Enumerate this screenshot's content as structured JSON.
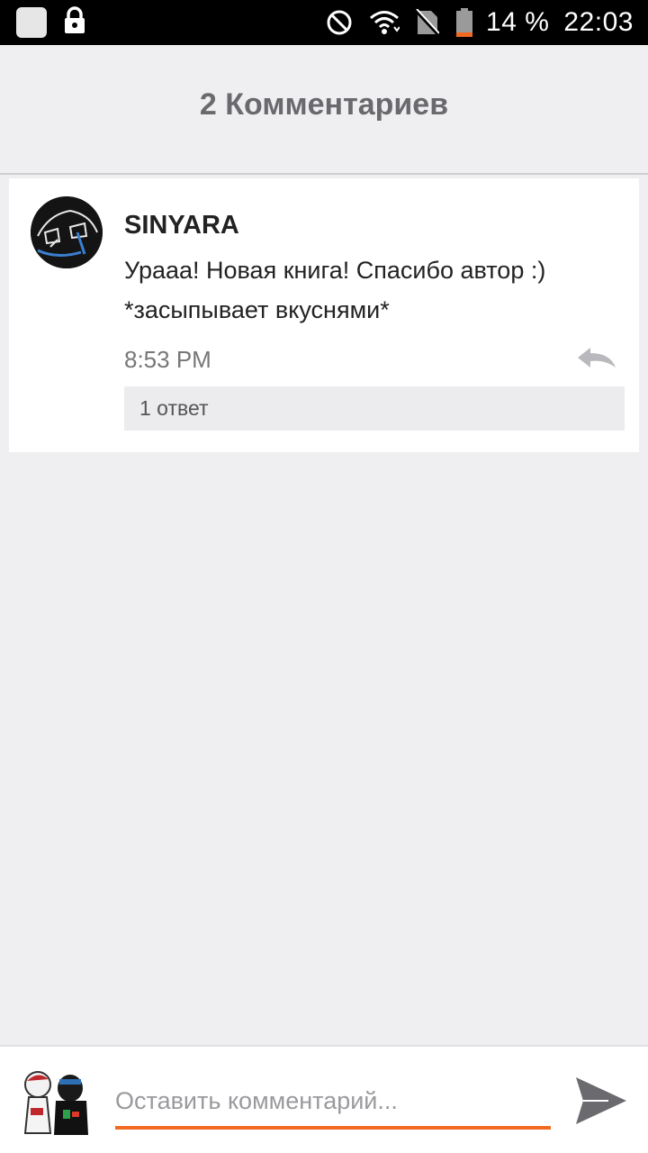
{
  "status_bar": {
    "battery": "14 %",
    "time": "22:03"
  },
  "header": {
    "title": "2 Комментариев"
  },
  "comment": {
    "author": "SINYARA",
    "text": "Урааа! Новая книга! Спасибо автор :) *засыпывает вкуснями*",
    "time": "8:53 PM",
    "replies_label": "1 ответ"
  },
  "composer": {
    "placeholder": "Оставить комментарий..."
  },
  "colors": {
    "accent": "#f26a21",
    "battery_low": "#f26a21"
  },
  "icons": [
    "app-icon",
    "lock-icon",
    "do-not-disturb-icon",
    "wifi-icon",
    "no-sim-icon",
    "battery-icon",
    "reply-icon",
    "send-icon"
  ]
}
